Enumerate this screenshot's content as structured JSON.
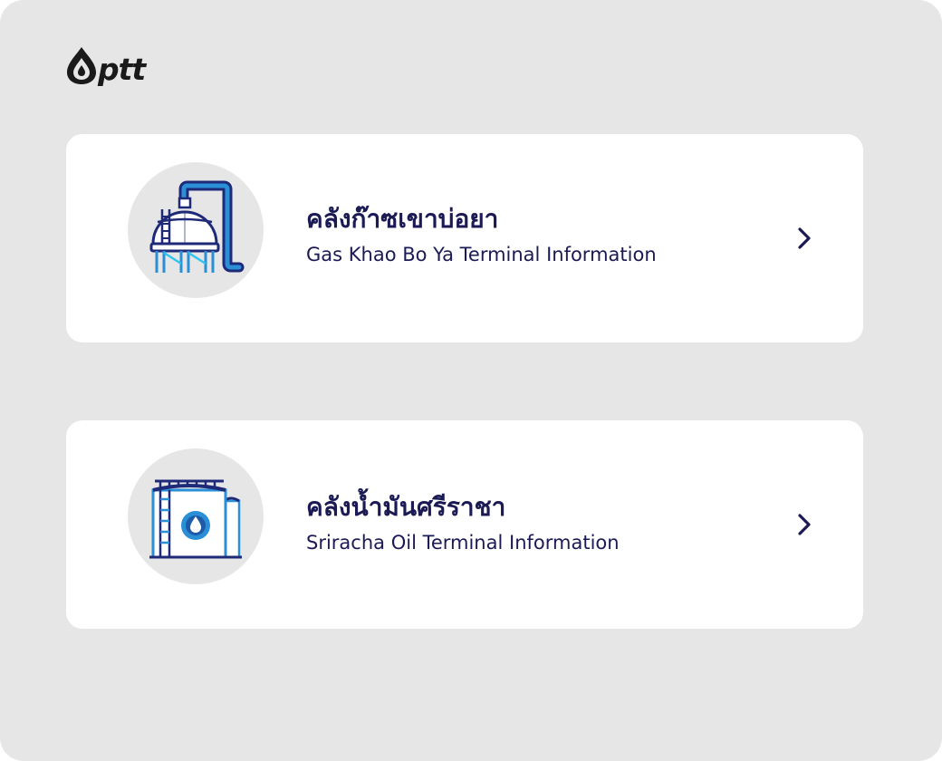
{
  "brand": {
    "logo_text": "ptt",
    "logo_color": "#1a1a1a"
  },
  "terminals": [
    {
      "title_th": "คลังก๊าซเขาบ่อยา",
      "title_en": "Gas  Khao Bo Ya Terminal Information",
      "icon": "gas-spherical-tank-icon",
      "action_icon": "chevron-right-icon"
    },
    {
      "title_th": "คลังน้ำมันศรีราชา",
      "title_en": "Sriracha Oil Terminal Information",
      "icon": "oil-storage-tank-icon",
      "action_icon": "chevron-right-icon"
    }
  ],
  "colors": {
    "background": "#e6e6e6",
    "card": "#ffffff",
    "text": "#1b1a55",
    "icon_navy": "#1e2a78",
    "icon_blue": "#2a8fd6",
    "icon_cyan": "#2ec6f0"
  }
}
